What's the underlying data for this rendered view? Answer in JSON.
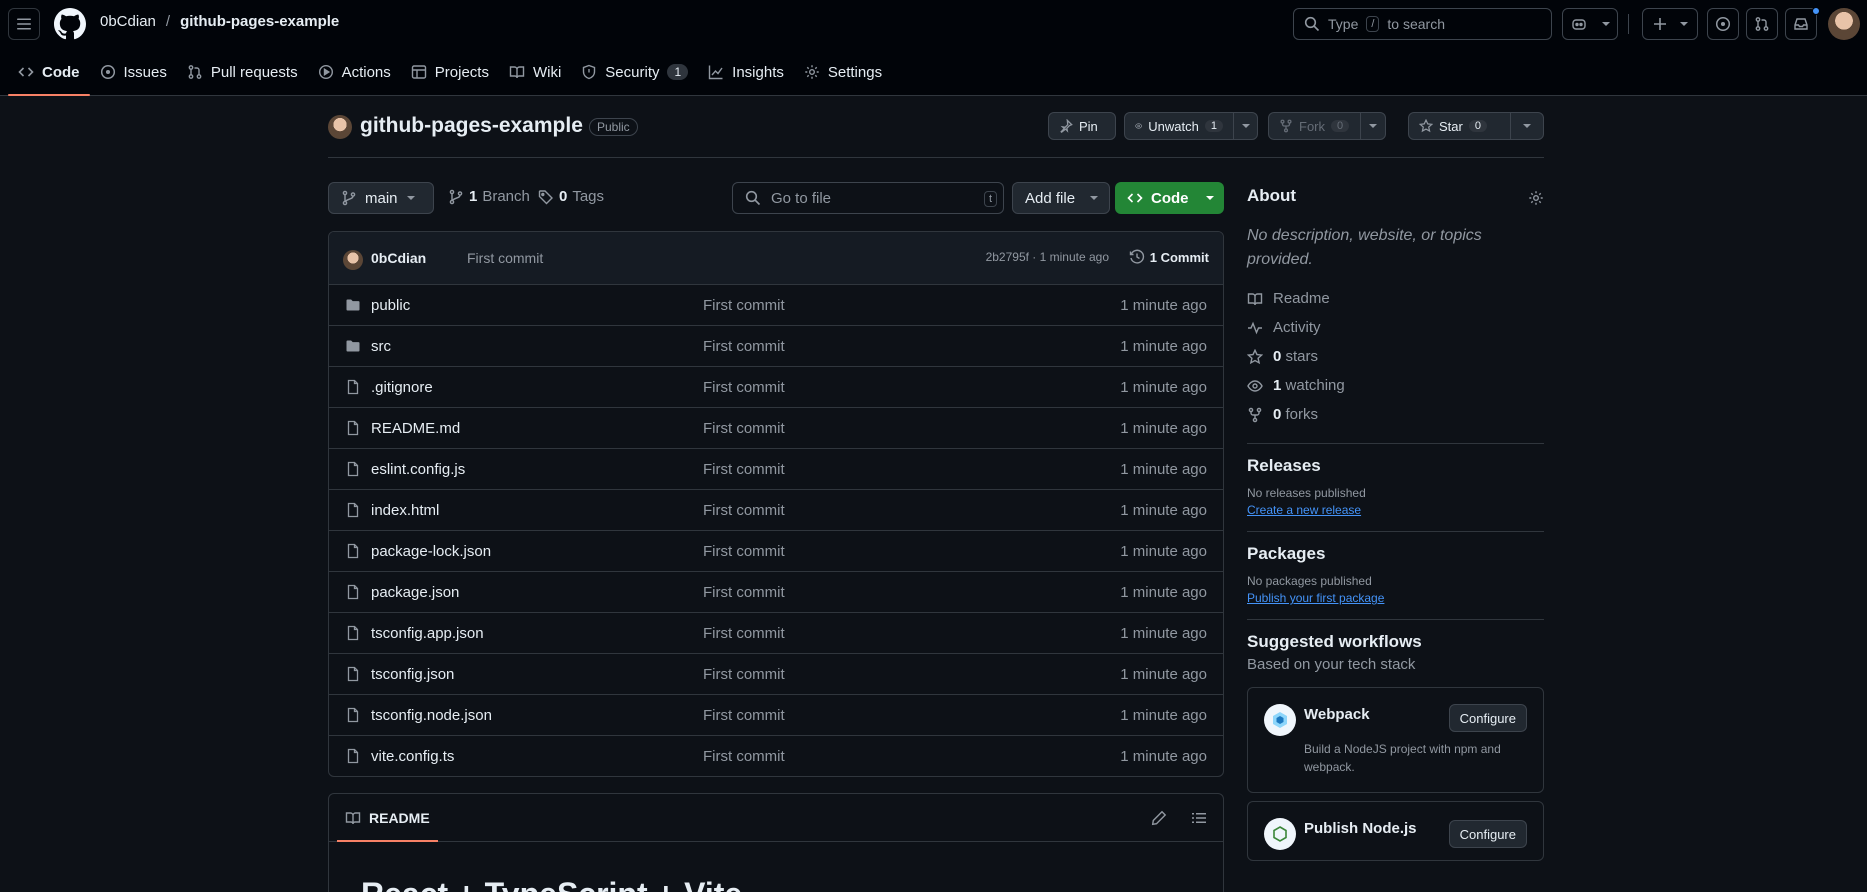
{
  "header": {
    "owner": "0bCdian",
    "separator": "/",
    "repo": "github-pages-example",
    "search_before": "Type",
    "search_key": "/",
    "search_after": "to search"
  },
  "tabs": [
    {
      "label": "Code"
    },
    {
      "label": "Issues"
    },
    {
      "label": "Pull requests"
    },
    {
      "label": "Actions"
    },
    {
      "label": "Projects"
    },
    {
      "label": "Wiki"
    },
    {
      "label": "Security",
      "count": "1"
    },
    {
      "label": "Insights"
    },
    {
      "label": "Settings"
    }
  ],
  "repo_head": {
    "name": "github-pages-example",
    "visibility": "Public",
    "pin_label": "Pin",
    "unwatch_label": "Unwatch",
    "unwatch_count": "1",
    "fork_label": "Fork",
    "fork_count": "0",
    "star_label": "Star",
    "star_count": "0"
  },
  "toolbar": {
    "branch": "main",
    "branch_count": "1",
    "branch_label": "Branch",
    "tag_count": "0",
    "tag_label": "Tags",
    "goto_placeholder": "Go to file",
    "goto_key": "t",
    "add_file": "Add file",
    "code": "Code"
  },
  "commit": {
    "author": "0bCdian",
    "message": "First commit",
    "hash_time": "2b2795f · 1 minute ago",
    "count_label": "1 Commit"
  },
  "files": [
    {
      "type": "dir",
      "name": "public",
      "message": "First commit",
      "time": "1 minute ago"
    },
    {
      "type": "dir",
      "name": "src",
      "message": "First commit",
      "time": "1 minute ago"
    },
    {
      "type": "file",
      "name": ".gitignore",
      "message": "First commit",
      "time": "1 minute ago"
    },
    {
      "type": "file",
      "name": "README.md",
      "message": "First commit",
      "time": "1 minute ago"
    },
    {
      "type": "file",
      "name": "eslint.config.js",
      "message": "First commit",
      "time": "1 minute ago"
    },
    {
      "type": "file",
      "name": "index.html",
      "message": "First commit",
      "time": "1 minute ago"
    },
    {
      "type": "file",
      "name": "package-lock.json",
      "message": "First commit",
      "time": "1 minute ago"
    },
    {
      "type": "file",
      "name": "package.json",
      "message": "First commit",
      "time": "1 minute ago"
    },
    {
      "type": "file",
      "name": "tsconfig.app.json",
      "message": "First commit",
      "time": "1 minute ago"
    },
    {
      "type": "file",
      "name": "tsconfig.json",
      "message": "First commit",
      "time": "1 minute ago"
    },
    {
      "type": "file",
      "name": "tsconfig.node.json",
      "message": "First commit",
      "time": "1 minute ago"
    },
    {
      "type": "file",
      "name": "vite.config.ts",
      "message": "First commit",
      "time": "1 minute ago"
    }
  ],
  "readme": {
    "tab_label": "README",
    "heading": "React + TypeScript + Vite"
  },
  "about": {
    "title": "About",
    "description": "No description, website, or topics provided.",
    "readme": "Readme",
    "activity": "Activity",
    "stars_count": "0",
    "stars_label": "stars",
    "watching_count": "1",
    "watching_label": "watching",
    "forks_count": "0",
    "forks_label": "forks"
  },
  "releases": {
    "title": "Releases",
    "none": "No releases published",
    "link": "Create a new release"
  },
  "packages": {
    "title": "Packages",
    "none": "No packages published",
    "link": "Publish your first package"
  },
  "workflows": {
    "title": "Suggested workflows",
    "subtitle": "Based on your tech stack",
    "items": [
      {
        "name": "Webpack",
        "desc": "Build a NodeJS project with npm and webpack.",
        "button": "Configure"
      },
      {
        "name": "Publish Node.js",
        "button": "Configure"
      }
    ]
  },
  "colors": {
    "accent_underline": "#f78166",
    "code_button": "#238636",
    "link": "#4493f8",
    "background": "#0d1117",
    "header_background": "#010409"
  },
  "icons": [
    "hamburger-icon",
    "github-logo-icon",
    "search-icon",
    "copilot-icon",
    "plus-icon",
    "issue-opened-icon",
    "pull-request-icon",
    "inbox-icon",
    "code-icon",
    "play-icon",
    "table-icon",
    "book-icon",
    "shield-icon",
    "graph-icon",
    "gear-icon",
    "pin-icon",
    "eye-icon",
    "fork-icon",
    "star-icon",
    "branch-icon",
    "tag-icon",
    "history-icon",
    "folder-icon",
    "file-icon",
    "pencil-icon",
    "list-icon",
    "pulse-icon"
  ]
}
